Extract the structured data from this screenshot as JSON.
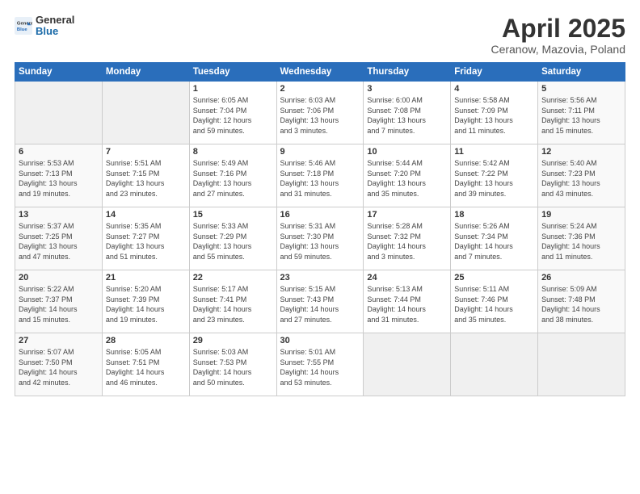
{
  "header": {
    "logo_general": "General",
    "logo_blue": "Blue",
    "title": "April 2025",
    "location": "Ceranow, Mazovia, Poland"
  },
  "days_of_week": [
    "Sunday",
    "Monday",
    "Tuesday",
    "Wednesday",
    "Thursday",
    "Friday",
    "Saturday"
  ],
  "weeks": [
    [
      {
        "day": "",
        "text": ""
      },
      {
        "day": "",
        "text": ""
      },
      {
        "day": "1",
        "text": "Sunrise: 6:05 AM\nSunset: 7:04 PM\nDaylight: 12 hours\nand 59 minutes."
      },
      {
        "day": "2",
        "text": "Sunrise: 6:03 AM\nSunset: 7:06 PM\nDaylight: 13 hours\nand 3 minutes."
      },
      {
        "day": "3",
        "text": "Sunrise: 6:00 AM\nSunset: 7:08 PM\nDaylight: 13 hours\nand 7 minutes."
      },
      {
        "day": "4",
        "text": "Sunrise: 5:58 AM\nSunset: 7:09 PM\nDaylight: 13 hours\nand 11 minutes."
      },
      {
        "day": "5",
        "text": "Sunrise: 5:56 AM\nSunset: 7:11 PM\nDaylight: 13 hours\nand 15 minutes."
      }
    ],
    [
      {
        "day": "6",
        "text": "Sunrise: 5:53 AM\nSunset: 7:13 PM\nDaylight: 13 hours\nand 19 minutes."
      },
      {
        "day": "7",
        "text": "Sunrise: 5:51 AM\nSunset: 7:15 PM\nDaylight: 13 hours\nand 23 minutes."
      },
      {
        "day": "8",
        "text": "Sunrise: 5:49 AM\nSunset: 7:16 PM\nDaylight: 13 hours\nand 27 minutes."
      },
      {
        "day": "9",
        "text": "Sunrise: 5:46 AM\nSunset: 7:18 PM\nDaylight: 13 hours\nand 31 minutes."
      },
      {
        "day": "10",
        "text": "Sunrise: 5:44 AM\nSunset: 7:20 PM\nDaylight: 13 hours\nand 35 minutes."
      },
      {
        "day": "11",
        "text": "Sunrise: 5:42 AM\nSunset: 7:22 PM\nDaylight: 13 hours\nand 39 minutes."
      },
      {
        "day": "12",
        "text": "Sunrise: 5:40 AM\nSunset: 7:23 PM\nDaylight: 13 hours\nand 43 minutes."
      }
    ],
    [
      {
        "day": "13",
        "text": "Sunrise: 5:37 AM\nSunset: 7:25 PM\nDaylight: 13 hours\nand 47 minutes."
      },
      {
        "day": "14",
        "text": "Sunrise: 5:35 AM\nSunset: 7:27 PM\nDaylight: 13 hours\nand 51 minutes."
      },
      {
        "day": "15",
        "text": "Sunrise: 5:33 AM\nSunset: 7:29 PM\nDaylight: 13 hours\nand 55 minutes."
      },
      {
        "day": "16",
        "text": "Sunrise: 5:31 AM\nSunset: 7:30 PM\nDaylight: 13 hours\nand 59 minutes."
      },
      {
        "day": "17",
        "text": "Sunrise: 5:28 AM\nSunset: 7:32 PM\nDaylight: 14 hours\nand 3 minutes."
      },
      {
        "day": "18",
        "text": "Sunrise: 5:26 AM\nSunset: 7:34 PM\nDaylight: 14 hours\nand 7 minutes."
      },
      {
        "day": "19",
        "text": "Sunrise: 5:24 AM\nSunset: 7:36 PM\nDaylight: 14 hours\nand 11 minutes."
      }
    ],
    [
      {
        "day": "20",
        "text": "Sunrise: 5:22 AM\nSunset: 7:37 PM\nDaylight: 14 hours\nand 15 minutes."
      },
      {
        "day": "21",
        "text": "Sunrise: 5:20 AM\nSunset: 7:39 PM\nDaylight: 14 hours\nand 19 minutes."
      },
      {
        "day": "22",
        "text": "Sunrise: 5:17 AM\nSunset: 7:41 PM\nDaylight: 14 hours\nand 23 minutes."
      },
      {
        "day": "23",
        "text": "Sunrise: 5:15 AM\nSunset: 7:43 PM\nDaylight: 14 hours\nand 27 minutes."
      },
      {
        "day": "24",
        "text": "Sunrise: 5:13 AM\nSunset: 7:44 PM\nDaylight: 14 hours\nand 31 minutes."
      },
      {
        "day": "25",
        "text": "Sunrise: 5:11 AM\nSunset: 7:46 PM\nDaylight: 14 hours\nand 35 minutes."
      },
      {
        "day": "26",
        "text": "Sunrise: 5:09 AM\nSunset: 7:48 PM\nDaylight: 14 hours\nand 38 minutes."
      }
    ],
    [
      {
        "day": "27",
        "text": "Sunrise: 5:07 AM\nSunset: 7:50 PM\nDaylight: 14 hours\nand 42 minutes."
      },
      {
        "day": "28",
        "text": "Sunrise: 5:05 AM\nSunset: 7:51 PM\nDaylight: 14 hours\nand 46 minutes."
      },
      {
        "day": "29",
        "text": "Sunrise: 5:03 AM\nSunset: 7:53 PM\nDaylight: 14 hours\nand 50 minutes."
      },
      {
        "day": "30",
        "text": "Sunrise: 5:01 AM\nSunset: 7:55 PM\nDaylight: 14 hours\nand 53 minutes."
      },
      {
        "day": "",
        "text": ""
      },
      {
        "day": "",
        "text": ""
      },
      {
        "day": "",
        "text": ""
      }
    ]
  ]
}
